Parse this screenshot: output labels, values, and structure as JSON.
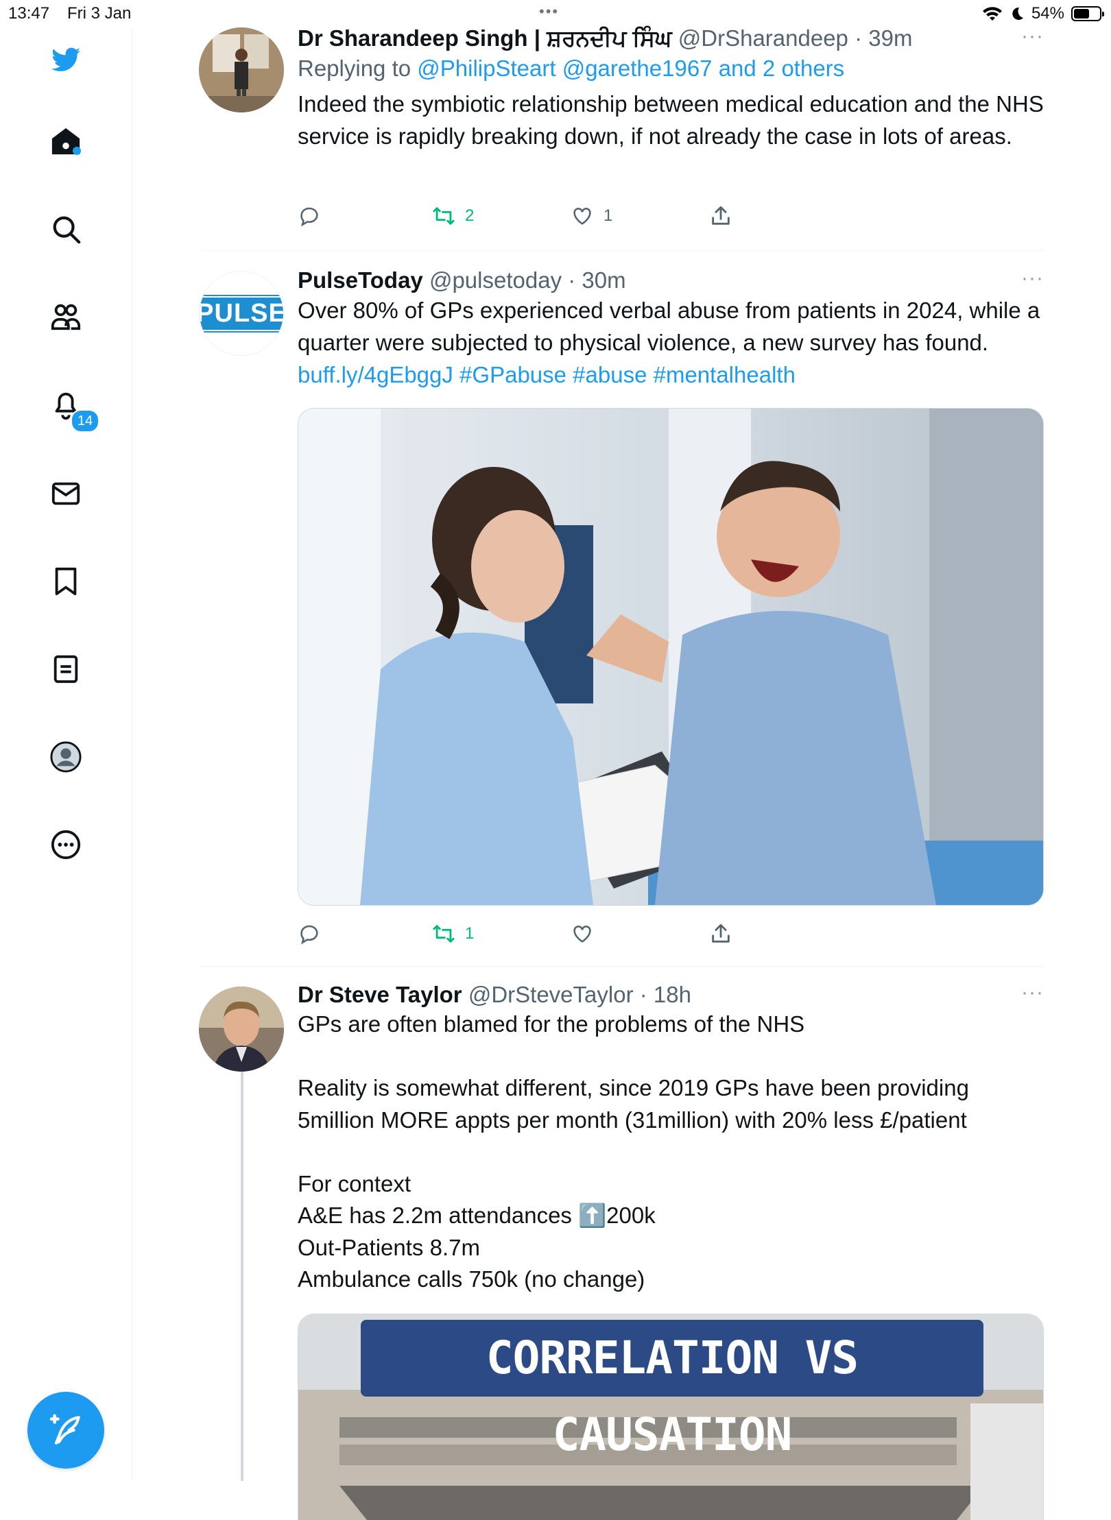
{
  "status_bar": {
    "time": "13:47",
    "date": "Fri 3 Jan",
    "battery": "54%",
    "battery_level": 0.54
  },
  "sidebar": {
    "items": [
      {
        "icon": "twitter-bird-icon"
      },
      {
        "icon": "home-icon"
      },
      {
        "icon": "search-icon"
      },
      {
        "icon": "communities-icon"
      },
      {
        "icon": "notifications-icon",
        "badge": "14"
      },
      {
        "icon": "messages-icon"
      },
      {
        "icon": "bookmarks-icon"
      },
      {
        "icon": "lists-icon"
      },
      {
        "icon": "profile-icon"
      },
      {
        "icon": "more-icon"
      }
    ],
    "compose_icon": "compose-tweet-icon"
  },
  "tweets": [
    {
      "name": "Dr Sharandeep Singh | ਸ਼ਰਨਦੀਪ ਸਿੰਘ",
      "handle": "@DrSharandeep",
      "time": "· 39m",
      "reply_prefix": "Replying to",
      "reply_to": "@PhilipSteart @garethe1967 and 2 others",
      "text": "Indeed the symbiotic relationship between medical education and the NHS service is rapidly breaking down, if not already the case in lots of areas.",
      "retweets": "2",
      "likes": "1"
    },
    {
      "name": "PulseToday",
      "handle": "@pulsetoday",
      "time": "· 30m",
      "avatar_logo": "PULSE",
      "text": "Over 80% of GPs experienced verbal abuse from patients in 2024, while a quarter were subjected to physical violence, a new survey has found. ",
      "link_text": "buff.ly/4gEbggJ #GPabuse #abuse #mentalhealth",
      "retweets": "1",
      "likes": ""
    },
    {
      "name": "Dr Steve Taylor",
      "handle": "@DrSteveTaylor",
      "time": "· 18h",
      "text": "GPs are often blamed for the problems of the NHS\n\nReality is somewhat different, since 2019 GPs have been providing 5million MORE appts per month (31million) with 20% less £/patient\n\nFor context\nA&E has 2.2m attendances ⬆️200k\nOut-Patients 8.7m\nAmbulance calls 750k (no change)",
      "media_banner": "CORRELATION VS CAUSATION"
    }
  ],
  "more_label": "···",
  "top_dots": "•••"
}
